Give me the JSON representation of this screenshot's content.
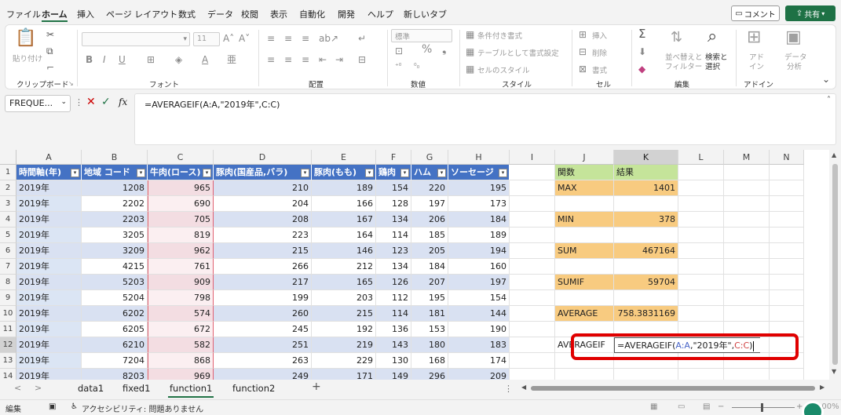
{
  "menu": {
    "tabs": [
      "ファイル",
      "ホーム",
      "挿入",
      "ページ レイアウト",
      "数式",
      "データ",
      "校閲",
      "表示",
      "自動化",
      "開発",
      "ヘルプ",
      "新しいタブ"
    ],
    "comment_label": "コメント",
    "share_label": "共有"
  },
  "ribbon": {
    "groups": [
      "クリップボード",
      "フォント",
      "配置",
      "数値",
      "スタイル",
      "セル",
      "編集",
      "アドイン"
    ],
    "paste_label": "貼り付け",
    "font_size": "11",
    "number_format": "標準",
    "cond_format": "条件付き書式",
    "table_format": "テーブルとして書式設定",
    "cell_style": "セルのスタイル",
    "insert": "挿入",
    "delete": "削除",
    "format": "書式",
    "sort_filter_1": "並べ替えと",
    "sort_filter_2": "フィルター",
    "find_select_1": "検索と",
    "find_select_2": "選択",
    "addin_1": "アド",
    "addin_2": "イン",
    "data_analysis_1": "データ",
    "data_analysis_2": "分析"
  },
  "formula_bar": {
    "name_box": "FREQUE...",
    "fx": "fx",
    "formula": "=AVERAGEIF(A:A,\"2019年\",C:C)"
  },
  "grid": {
    "columns": [
      "A",
      "B",
      "C",
      "D",
      "E",
      "F",
      "G",
      "H",
      "I",
      "J",
      "K",
      "L",
      "M",
      "N"
    ],
    "rows": [
      "1",
      "2",
      "3",
      "4",
      "5",
      "6",
      "7",
      "8",
      "9",
      "10",
      "11",
      "12",
      "13",
      "14"
    ],
    "table_headers": [
      "時間軸(年)",
      "地域 コード",
      "牛肉(ロース)",
      "豚肉(国産品,バラ)",
      "豚肉(もも)",
      "鶏肉",
      "ハム",
      "ソーセージ"
    ],
    "table_rows": [
      [
        "2019年",
        "1208",
        "965",
        "210",
        "189",
        "154",
        "220",
        "195"
      ],
      [
        "2019年",
        "2202",
        "690",
        "204",
        "166",
        "128",
        "197",
        "173"
      ],
      [
        "2019年",
        "2203",
        "705",
        "208",
        "167",
        "134",
        "206",
        "184"
      ],
      [
        "2019年",
        "3205",
        "819",
        "223",
        "164",
        "114",
        "185",
        "189"
      ],
      [
        "2019年",
        "3209",
        "962",
        "215",
        "146",
        "123",
        "205",
        "194"
      ],
      [
        "2019年",
        "4215",
        "761",
        "266",
        "212",
        "134",
        "184",
        "160"
      ],
      [
        "2019年",
        "5203",
        "909",
        "217",
        "165",
        "126",
        "207",
        "197"
      ],
      [
        "2019年",
        "5204",
        "798",
        "199",
        "203",
        "112",
        "195",
        "154"
      ],
      [
        "2019年",
        "6202",
        "574",
        "260",
        "215",
        "114",
        "181",
        "144"
      ],
      [
        "2019年",
        "6205",
        "672",
        "245",
        "192",
        "136",
        "153",
        "190"
      ],
      [
        "2019年",
        "6210",
        "582",
        "251",
        "219",
        "143",
        "180",
        "183"
      ],
      [
        "2019年",
        "7204",
        "868",
        "263",
        "229",
        "130",
        "168",
        "174"
      ],
      [
        "2019年",
        "8203",
        "969",
        "249",
        "171",
        "149",
        "296",
        "209"
      ]
    ],
    "summary_header": {
      "label": "関数",
      "value": "結果"
    },
    "summary": [
      {
        "label": "MAX",
        "value": "1401"
      },
      {
        "label": "MIN",
        "value": "378"
      },
      {
        "label": "SUM",
        "value": "467164"
      },
      {
        "label": "SUMIF",
        "value": "59704"
      },
      {
        "label": "AVERAGE",
        "value": "758.3831169"
      },
      {
        "label": "AVERAGEIF",
        "value": ""
      }
    ],
    "editing": {
      "part1": "=AVERAGEIF(",
      "ref1": "A:A",
      "part2": ",\"2019年\",",
      "ref2": "C:C",
      "part3": ")"
    }
  },
  "sheets": {
    "tabs": [
      "data1",
      "fixed1",
      "function1",
      "function2"
    ],
    "active": "function1",
    "add_label": "+"
  },
  "status": {
    "mode": "編集",
    "accessibility": "アクセシビリティ: 問題ありません",
    "zoom": "100%"
  },
  "colors": {
    "accent": "#217346",
    "table_header": "#4472c4",
    "band": "#d9e1f2",
    "orange": "#f8cb80",
    "green": "#c5e49a",
    "callout": "#e00000"
  }
}
